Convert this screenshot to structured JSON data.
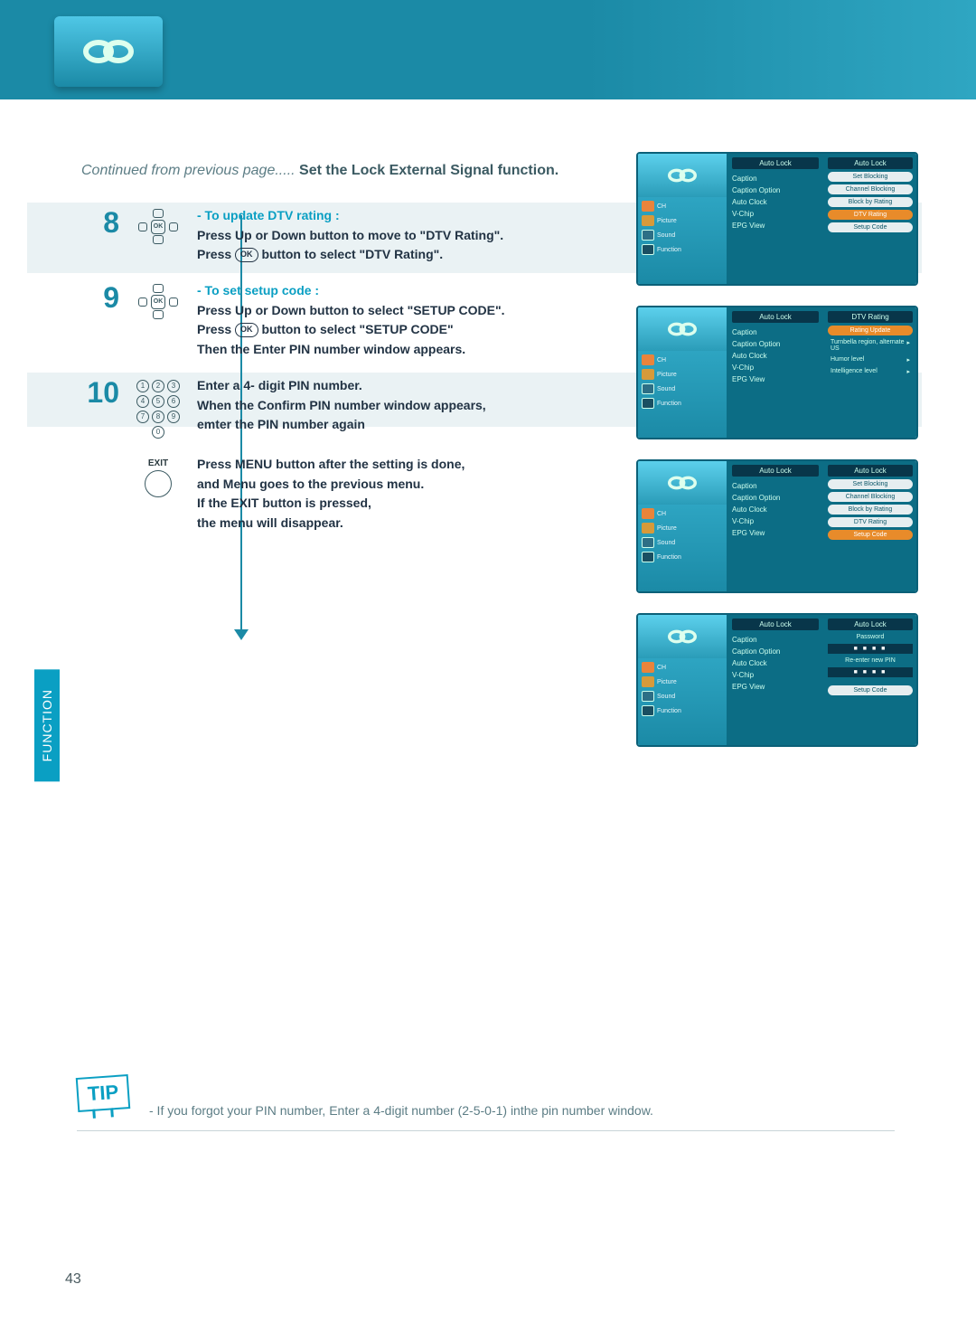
{
  "header": {
    "icon_name": "chain-icon"
  },
  "continued": {
    "prefix": "Continued from previous page.....",
    "title": "Set the Lock External Signal function."
  },
  "steps": [
    {
      "num": "8",
      "remote": "dpad",
      "title": "- To update DTV rating :",
      "lines": [
        "Press Up or Down button to move to \"DTV Rating\".",
        "Press ",
        " button to select  \"DTV Rating\"."
      ],
      "ok_inline": true
    },
    {
      "num": "9",
      "remote": "dpad",
      "title": "- To set setup code :",
      "lines": [
        "Press Up or Down button to select \"SETUP CODE\".",
        "Press ",
        " button to select \"SETUP CODE\"",
        "Then the Enter PIN number window appears."
      ],
      "ok_inline": true
    },
    {
      "num": "10",
      "remote": "numpad",
      "title": "",
      "lines": [
        "Enter a 4- digit PIN number.",
        "When the Confirm PIN number window appears,",
        "emter the PIN number again"
      ]
    },
    {
      "num": "",
      "remote": "exit",
      "exit_label": "EXIT",
      "title": "",
      "lines": [
        "Press MENU button after the setting is done,",
        "and Menu goes to the previous menu.",
        "If the EXIT button is pressed,",
        "the menu  will disappear."
      ]
    }
  ],
  "ok_label": "OK",
  "numpad_keys": [
    "1",
    "2",
    "3",
    "4",
    "5",
    "6",
    "7",
    "8",
    "9",
    "0"
  ],
  "osd": {
    "left_menu": {
      "header": "Auto Lock",
      "items": [
        "Caption",
        "Caption Option",
        "Auto Clock",
        "V-Chip",
        "EPG View"
      ]
    },
    "left_icons": [
      "CH",
      "Picture",
      "Sound",
      "Function"
    ],
    "panels": [
      {
        "right_header": "Auto Lock",
        "type": "pills",
        "items": [
          "Set Blocking",
          "Channel Blocking",
          "Block by Rating",
          "DTV Rating",
          "Setup Code"
        ],
        "highlight": 3
      },
      {
        "right_header": "DTV Rating",
        "type": "lines",
        "top_pill": "Rating Update",
        "items": [
          "Turnbella region, alternate US",
          "Humor level",
          "Intelligence level"
        ]
      },
      {
        "right_header": "Auto Lock",
        "type": "pills",
        "items": [
          "Set Blocking",
          "Channel Blocking",
          "Block by Rating",
          "DTV Rating",
          "Setup Code"
        ],
        "highlight": 4
      },
      {
        "right_header": "Auto Lock",
        "type": "pin",
        "password_label": "Password",
        "reenter_label": "Re-enter new PIN",
        "pin": "■ ■ ■ ■",
        "bottom": "Setup Code"
      }
    ]
  },
  "side_tab": "FUNCTION",
  "tip": {
    "label": "TIP",
    "text": "- If you forgot your PIN number, Enter a 4-digit number (2-5-0-1) inthe pin number window."
  },
  "page_number": "43"
}
